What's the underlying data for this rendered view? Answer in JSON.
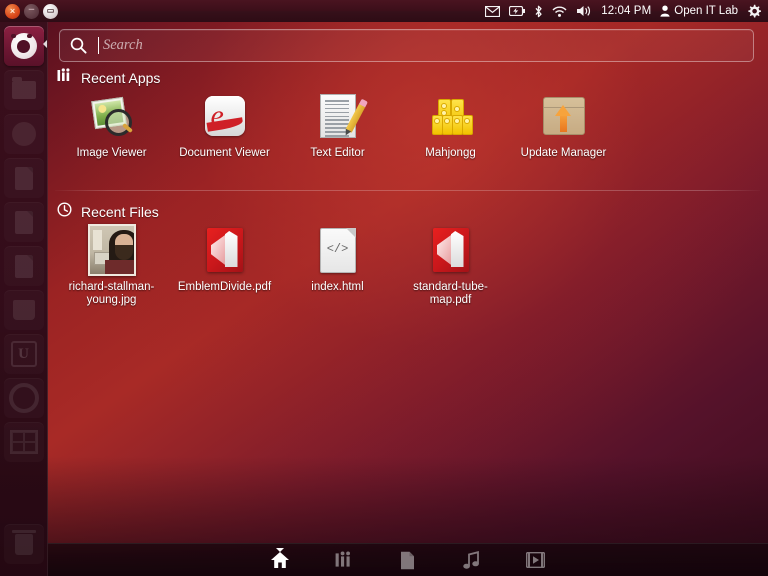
{
  "window_controls": [
    {
      "name": "close",
      "glyph": "×"
    },
    {
      "name": "minimize",
      "glyph": "−"
    },
    {
      "name": "maximize",
      "glyph": "▭"
    }
  ],
  "top_panel": {
    "indicators": [
      {
        "name": "messaging-icon",
        "glyph": "✉"
      },
      {
        "name": "battery-icon",
        "glyph": "▬"
      },
      {
        "name": "bluetooth-icon",
        "glyph": "ᛦ"
      },
      {
        "name": "network-icon",
        "glyph": "◠"
      },
      {
        "name": "volume-icon",
        "glyph": "▶"
      }
    ],
    "clock": "12:04 PM",
    "user_icon": "user-icon",
    "username": "Open IT Lab",
    "settings_icon": "gear-icon"
  },
  "launcher": {
    "items": [
      {
        "name": "dash-home-bfb",
        "label": "Ubuntu Dash"
      },
      {
        "name": "files-nautilus",
        "label": "Files"
      },
      {
        "name": "firefox",
        "label": "Firefox Web Browser"
      },
      {
        "name": "libreoffice-writer",
        "label": "LibreOffice Writer"
      },
      {
        "name": "libreoffice-calc",
        "label": "LibreOffice Calc"
      },
      {
        "name": "libreoffice-impress",
        "label": "LibreOffice Impress"
      },
      {
        "name": "ubuntu-software-center",
        "label": "Ubuntu Software Center"
      },
      {
        "name": "ubuntu-one",
        "label": "Ubuntu One"
      },
      {
        "name": "system-settings",
        "label": "System Settings"
      },
      {
        "name": "workspace-switcher",
        "label": "Workspace Switcher"
      },
      {
        "name": "trash",
        "label": "Trash"
      }
    ]
  },
  "search": {
    "placeholder": "Search",
    "value": ""
  },
  "groups": [
    {
      "title": "Recent Apps",
      "icon": "applications-icon",
      "items": [
        {
          "label": "Image Viewer",
          "icon": "image-viewer-icon"
        },
        {
          "label": "Document Viewer",
          "icon": "document-viewer-icon"
        },
        {
          "label": "Text Editor",
          "icon": "text-editor-icon"
        },
        {
          "label": "Mahjongg",
          "icon": "mahjongg-icon"
        },
        {
          "label": "Update Manager",
          "icon": "update-manager-icon"
        }
      ]
    },
    {
      "title": "Recent Files",
      "icon": "clock-icon",
      "items": [
        {
          "label": "richard-stallman-young.jpg",
          "icon": "photo-thumbnail"
        },
        {
          "label": "EmblemDivide.pdf",
          "icon": "pdf-icon"
        },
        {
          "label": "index.html",
          "icon": "html-file-icon"
        },
        {
          "label": "standard-tube-map.pdf",
          "icon": "pdf-icon"
        }
      ]
    }
  ],
  "lens_bar": {
    "lenses": [
      {
        "name": "home-lens",
        "label": "Home",
        "active": true
      },
      {
        "name": "applications-lens",
        "label": "Applications",
        "active": false
      },
      {
        "name": "files-lens",
        "label": "Files & Folders",
        "active": false
      },
      {
        "name": "music-lens",
        "label": "Music",
        "active": false
      },
      {
        "name": "video-lens",
        "label": "Videos",
        "active": false
      }
    ]
  },
  "colors": {
    "accent": "#dd4814",
    "panel": "#3c0f1a",
    "dash": "#a82a26"
  }
}
